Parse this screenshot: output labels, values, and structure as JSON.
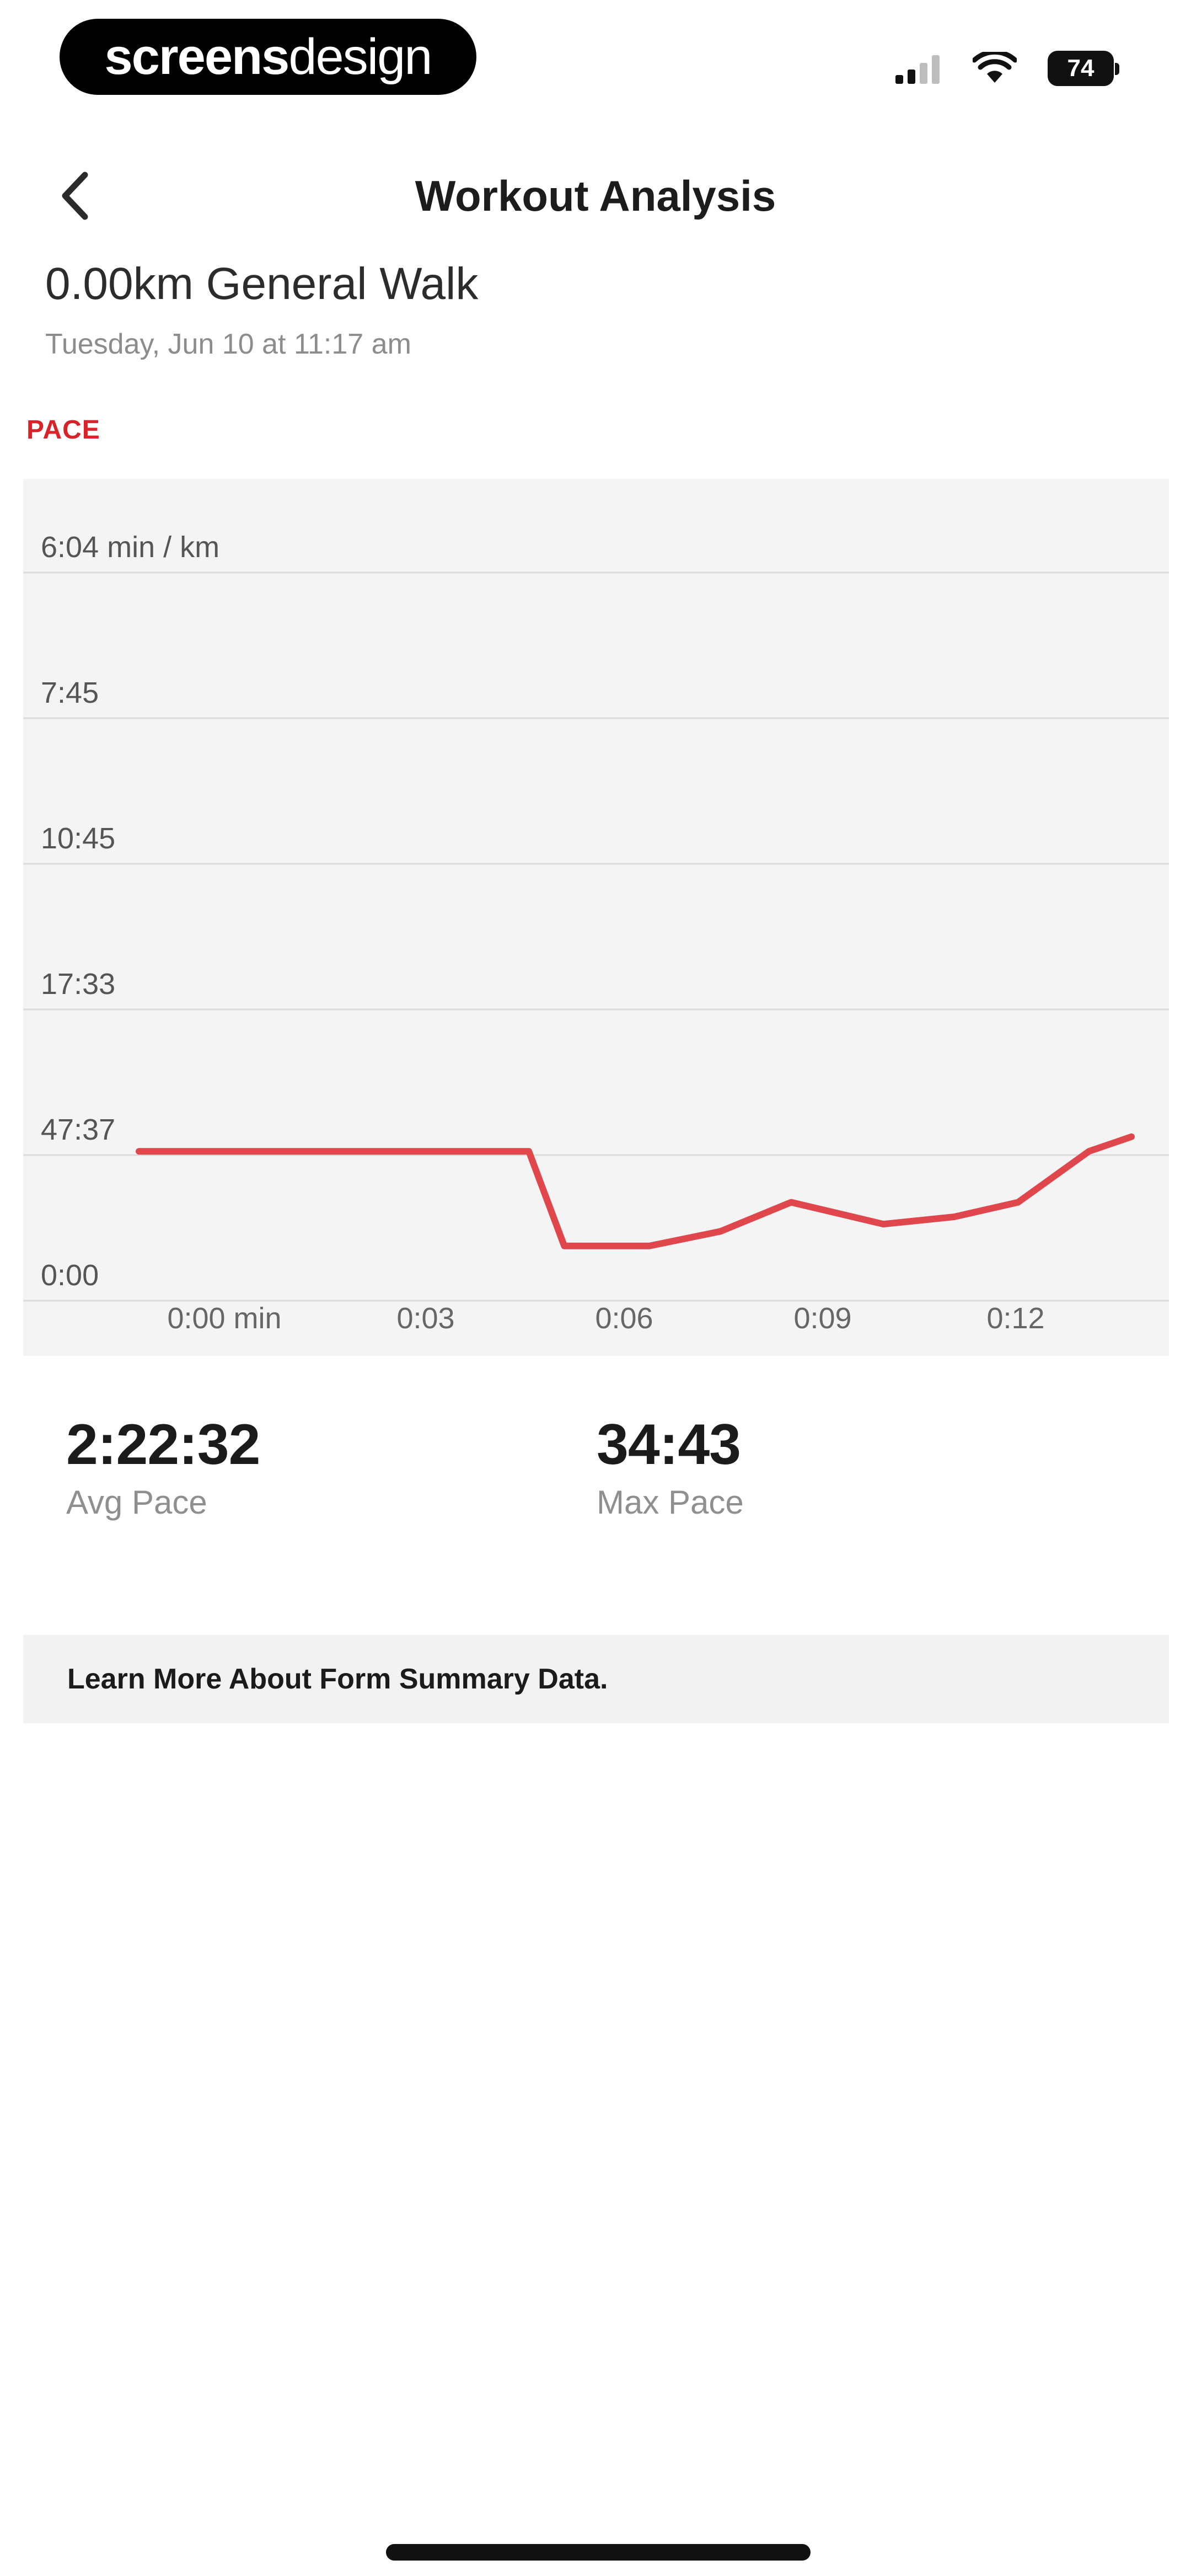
{
  "status_bar": {
    "brand_bold": "screens",
    "brand_light": "design",
    "battery_level": "74",
    "icons": [
      "signal-icon",
      "wifi-icon",
      "battery-icon"
    ]
  },
  "header": {
    "title": "Workout Analysis",
    "back_icon": "chevron-left-icon"
  },
  "workout": {
    "name": "0.00km General Walk",
    "date": "Tuesday, Jun 10 at 11:17 am"
  },
  "section_label": "PACE",
  "chart_data": {
    "type": "line",
    "y_tick_labels": [
      "6:04 min / km",
      "7:45",
      "10:45",
      "17:33",
      "47:37",
      "0:00"
    ],
    "x_tick_labels": [
      "0:00 min",
      "0:03",
      "0:06",
      "0:09",
      "0:12"
    ],
    "x_range_min": [
      0,
      14
    ],
    "series": [
      {
        "color": "#e0474c",
        "points": [
          {
            "x": 0.0,
            "y_band": 4.05
          },
          {
            "x": 5.5,
            "y_band": 4.05
          },
          {
            "x": 6.0,
            "y_band": 4.7
          },
          {
            "x": 7.2,
            "y_band": 4.7
          },
          {
            "x": 8.2,
            "y_band": 4.6
          },
          {
            "x": 9.2,
            "y_band": 4.4
          },
          {
            "x": 10.5,
            "y_band": 4.55
          },
          {
            "x": 11.5,
            "y_band": 4.5
          },
          {
            "x": 12.4,
            "y_band": 4.4
          },
          {
            "x": 13.4,
            "y_band": 4.05
          },
          {
            "x": 14.0,
            "y_band": 3.95
          }
        ]
      }
    ],
    "grid": true,
    "line_color": "#e0474c"
  },
  "stats": {
    "avg_value": "2:22:32",
    "avg_label": "Avg Pace",
    "max_value": "34:43",
    "max_label": "Max Pace"
  },
  "info_link": {
    "label": "Learn More About Form Summary Data."
  }
}
